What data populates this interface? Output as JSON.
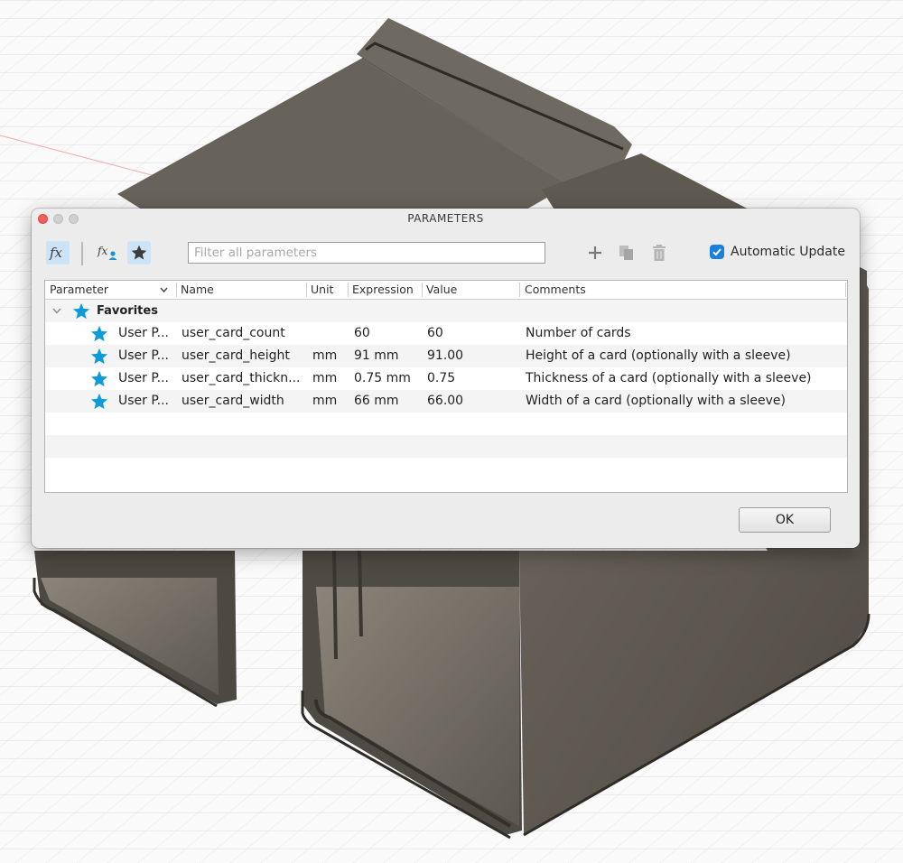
{
  "dialog": {
    "title": "PARAMETERS"
  },
  "toolbar": {
    "filter_placeholder": "Filter all parameters",
    "automatic_update_label": "Automatic Update",
    "automatic_update_checked": true
  },
  "table": {
    "columns": [
      "Parameter",
      "Name",
      "Unit",
      "Expression",
      "Value",
      "Comments"
    ],
    "group": {
      "label": "Favorites"
    },
    "rows": [
      {
        "parameter": "User P...",
        "name": "user_card_count",
        "unit": "",
        "expression": "60",
        "value": "60",
        "comment": "Number of cards"
      },
      {
        "parameter": "User P...",
        "name": "user_card_height",
        "unit": "mm",
        "expression": "91 mm",
        "value": "91.00",
        "comment": "Height of a card (optionally with a sleeve)"
      },
      {
        "parameter": "User P...",
        "name": "user_card_thickn...",
        "unit": "mm",
        "expression": "0.75 mm",
        "value": "0.75",
        "comment": "Thickness of a card (optionally with a sleeve)"
      },
      {
        "parameter": "User P...",
        "name": "user_card_width",
        "unit": "mm",
        "expression": "66 mm",
        "value": "66.00",
        "comment": "Width of a card (optionally with a sleeve)"
      }
    ]
  },
  "buttons": {
    "ok": "OK"
  },
  "colors": {
    "accent": "#1b7fe0",
    "star": "#0f9ad8",
    "model": "#5a554d"
  }
}
